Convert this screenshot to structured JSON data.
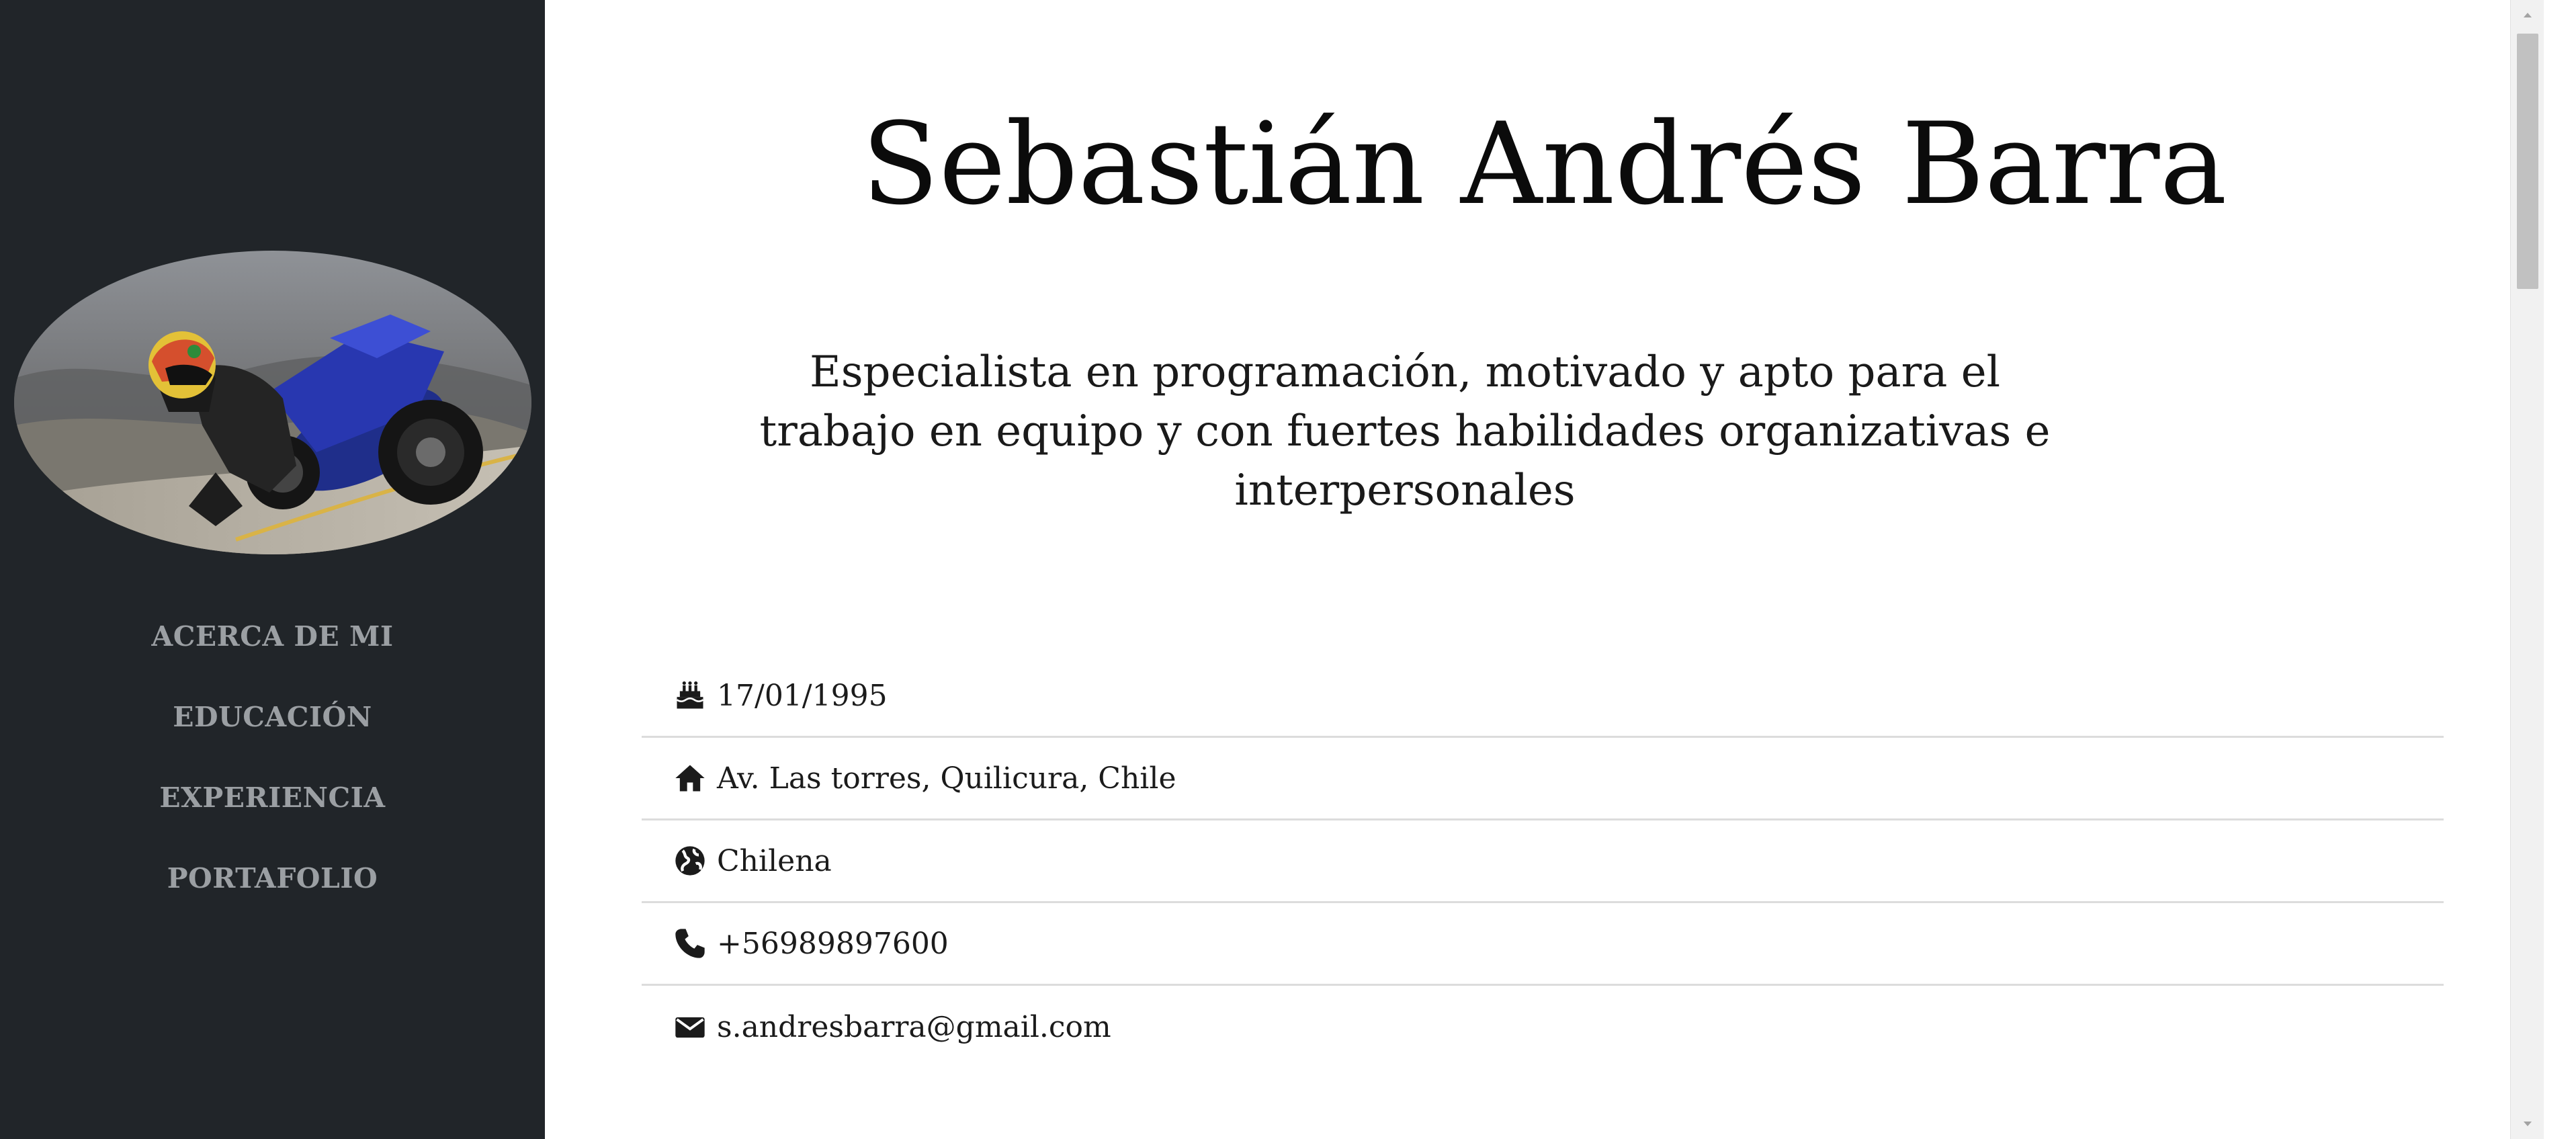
{
  "profile": {
    "name": "Sebastián Andrés Barra",
    "tagline": "Especialista en programación, motivado y apto para el trabajo en equipo y con fuertes habilidades organizativas e interpersonales"
  },
  "sidebar": {
    "nav": [
      {
        "label": "ACERCA DE MI"
      },
      {
        "label": "EDUCACIÓN"
      },
      {
        "label": "EXPERIENCIA"
      },
      {
        "label": "PORTAFOLIO"
      }
    ]
  },
  "info": {
    "birthdate": {
      "icon": "birthday-cake-icon",
      "value": "17/01/1995"
    },
    "address": {
      "icon": "home-icon",
      "value": "Av. Las torres, Quilicura, Chile"
    },
    "nationality": {
      "icon": "globe-icon",
      "value": "Chilena"
    },
    "phone": {
      "icon": "phone-icon",
      "value": "+56989897600"
    },
    "email": {
      "icon": "envelope-icon",
      "value": "s.andresbarra@gmail.com"
    }
  },
  "colors": {
    "sidebar_bg": "#212529",
    "nav_text": "#9b9fa3",
    "main_bg": "#ffffff",
    "divider": "#dcdcdc"
  }
}
